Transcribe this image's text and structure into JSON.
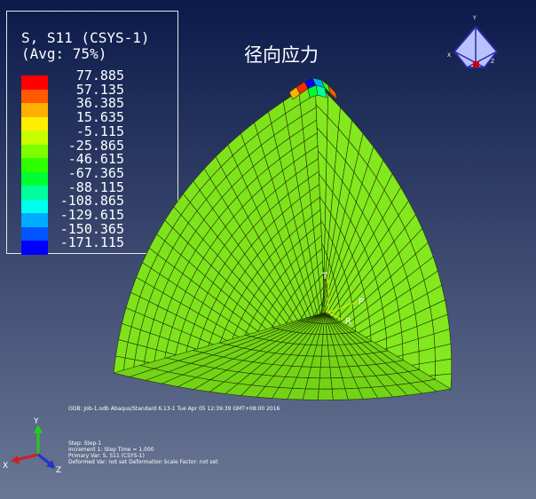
{
  "viewport": {
    "background_top": "#0b1a4a",
    "background_bottom": "#6a7794"
  },
  "legend": {
    "title_line1": "S, S11 (CSYS-1)",
    "title_line2": "(Avg: 75%)",
    "values": [
      "77.885",
      "57.135",
      "36.385",
      "15.635",
      "-5.115",
      "-25.865",
      "-46.615",
      "-67.365",
      "-88.115",
      "-108.865",
      "-129.615",
      "-150.365",
      "-171.115"
    ],
    "colors": [
      "#ff0000",
      "#ff5a00",
      "#ffb000",
      "#ffee00",
      "#c8ff00",
      "#7dff00",
      "#2eff00",
      "#00ff32",
      "#00ff9a",
      "#00ffee",
      "#00aaff",
      "#0055ff",
      "#0000ff"
    ]
  },
  "plot": {
    "title": "径向应力",
    "mesh_color": "#7ee21a",
    "edge_color": "#1f3600"
  },
  "mesh_labels": {
    "t": "T",
    "p": "P",
    "r": "R"
  },
  "triad_top": {
    "y": "Y",
    "x": "X",
    "z": "Z"
  },
  "triad_bottom": {
    "y": "Y",
    "x": "X",
    "z": "Z"
  },
  "footer": {
    "odb_line": "ODB: Job-1.odb    Abaqus/Standard 6.13-1    Tue Apr 05 12:39:39 GMT+08:00 2016",
    "step_line": "Step: Step-1",
    "increment_line": "Increment      1: Step Time =    1.000",
    "primary_var_line": "Primary Var: S, S11 (CSYS-1)",
    "deformed_var_line": "Deformed Var: not set    Deformation Scale Factor: not set"
  }
}
